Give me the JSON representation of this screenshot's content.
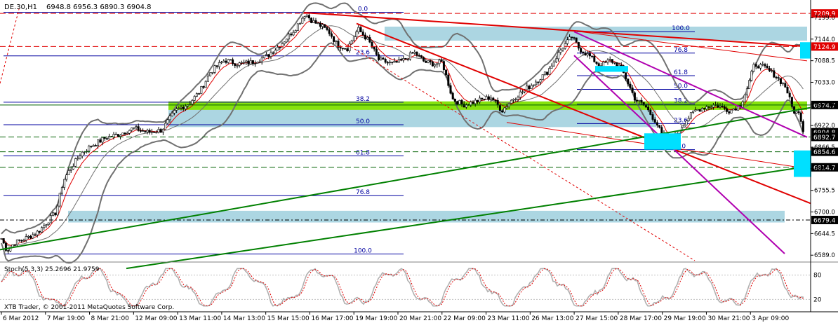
{
  "header": {
    "symbol": "DE.30,H1",
    "ohlc": "6948.8 6956.3 6890.3 6904.8"
  },
  "footer": {
    "copyright": "XTB Trader, © 2001-2011 MetaQuotes Software Corp."
  },
  "colors": {
    "candle": "#000000",
    "bollinger": "#707070",
    "ma": "#e00000",
    "fib": "#0000a0",
    "fib_zone": "#a8d4e0",
    "green_zone": "#7fe000",
    "trend_red": "#e00000",
    "trend_green": "#008000",
    "trend_magenta": "#b000b0",
    "cyan_block": "#00e0ff",
    "stoch_main": "#b0b0b0",
    "stoch_signal": "#e00000"
  },
  "chart_data": {
    "type": "candlestick",
    "instrument": "DE.30",
    "timeframe": "H1",
    "ohlc_last": {
      "open": 6948.8,
      "high": 6956.3,
      "low": 6890.3,
      "close": 6904.8
    },
    "ylim": [
      6575,
      7230
    ],
    "y_ticks": [
      7199.0,
      7144.0,
      7088.5,
      7033.0,
      6977.5,
      6922.0,
      6866.5,
      6811.0,
      6755.5,
      6700.0,
      6644.5,
      6589.0
    ],
    "x_ticks": [
      "6 Mar 2012",
      "7 Mar 19:00",
      "8 Mar 21:00",
      "12 Mar 09:00",
      "13 Mar 11:00",
      "14 Mar 13:00",
      "15 Mar 15:00",
      "16 Mar 17:00",
      "19 Mar 19:00",
      "20 Mar 21:00",
      "22 Mar 09:00",
      "23 Mar 11:00",
      "26 Mar 13:00",
      "27 Mar 15:00",
      "28 Mar 17:00",
      "29 Mar 19:00",
      "30 Mar 21:00",
      "3 Apr 09:00"
    ],
    "path": [
      [
        0,
        6640
      ],
      [
        10,
        6600
      ],
      [
        20,
        6620
      ],
      [
        40,
        6635
      ],
      [
        55,
        6650
      ],
      [
        70,
        6680
      ],
      [
        80,
        6700
      ],
      [
        90,
        6780
      ],
      [
        100,
        6810
      ],
      [
        115,
        6850
      ],
      [
        130,
        6870
      ],
      [
        150,
        6890
      ],
      [
        170,
        6900
      ],
      [
        190,
        6915
      ],
      [
        210,
        6905
      ],
      [
        230,
        6910
      ],
      [
        250,
        6960
      ],
      [
        270,
        6980
      ],
      [
        285,
        7010
      ],
      [
        300,
        7060
      ],
      [
        320,
        7090
      ],
      [
        340,
        7080
      ],
      [
        360,
        7085
      ],
      [
        380,
        7100
      ],
      [
        400,
        7130
      ],
      [
        420,
        7170
      ],
      [
        435,
        7210
      ],
      [
        445,
        7190
      ],
      [
        460,
        7175
      ],
      [
        470,
        7160
      ],
      [
        480,
        7130
      ],
      [
        495,
        7120
      ],
      [
        510,
        7170
      ],
      [
        525,
        7140
      ],
      [
        540,
        7090
      ],
      [
        560,
        7080
      ],
      [
        575,
        7090
      ],
      [
        590,
        7110
      ],
      [
        605,
        7085
      ],
      [
        620,
        7080
      ],
      [
        630,
        7085
      ],
      [
        645,
        6990
      ],
      [
        660,
        6975
      ],
      [
        680,
        6985
      ],
      [
        700,
        6995
      ],
      [
        715,
        6960
      ],
      [
        730,
        6990
      ],
      [
        745,
        7010
      ],
      [
        760,
        7030
      ],
      [
        780,
        7060
      ],
      [
        800,
        7120
      ],
      [
        815,
        7150
      ],
      [
        825,
        7120
      ],
      [
        840,
        7100
      ],
      [
        855,
        7075
      ],
      [
        870,
        7090
      ],
      [
        885,
        7070
      ],
      [
        895,
        7030
      ],
      [
        905,
        6990
      ],
      [
        920,
        6970
      ],
      [
        935,
        6930
      ],
      [
        950,
        6870
      ],
      [
        960,
        6890
      ],
      [
        975,
        6930
      ],
      [
        990,
        6960
      ],
      [
        1005,
        6970
      ],
      [
        1020,
        6975
      ],
      [
        1040,
        6960
      ],
      [
        1055,
        6975
      ],
      [
        1065,
        7020
      ],
      [
        1075,
        7080
      ],
      [
        1090,
        7070
      ],
      [
        1105,
        7050
      ],
      [
        1120,
        7020
      ],
      [
        1130,
        6960
      ],
      [
        1140,
        6950
      ],
      [
        1145,
        6904.8
      ]
    ],
    "fib_left": {
      "x1": 5,
      "x2": 575,
      "anchor_x": 517,
      "levels": [
        {
          "label": "0.0",
          "price": 7213
        },
        {
          "label": "23.6",
          "price": 7101
        },
        {
          "label": "38.2",
          "price": 6982
        },
        {
          "label": "50.0",
          "price": 6924
        },
        {
          "label": "61.8",
          "price": 6844
        },
        {
          "label": "76.8",
          "price": 6742
        },
        {
          "label": "100.0",
          "price": 6592
        }
      ]
    },
    "fib_right": {
      "x1": 822,
      "x2": 990,
      "anchor_x": 970,
      "levels": [
        {
          "label": "100.0",
          "price": 7163
        },
        {
          "label": "76.8",
          "price": 7108
        },
        {
          "label": "61.8",
          "price": 7050
        },
        {
          "label": "50.0",
          "price": 7015
        },
        {
          "label": "38.2",
          "price": 6977
        },
        {
          "label": "23.6",
          "price": 6927
        },
        {
          "label": "0.0",
          "price": 6860
        }
      ]
    },
    "horizontal_levels": [
      {
        "price": 7209.9,
        "label": "7209.9",
        "color": "#e00000",
        "style": "dashed"
      },
      {
        "price": 7124.9,
        "label": "7124.9",
        "color": "#e00000",
        "style": "dashed"
      },
      {
        "price": 6974.7,
        "label": "6974.7",
        "color": "#006000",
        "style": "solid"
      },
      {
        "price": 6904.8,
        "label": "6904.8",
        "color": "#000000",
        "style": "solid"
      },
      {
        "price": 6892.7,
        "label": "6892.7",
        "color": "#006000",
        "style": "dashed"
      },
      {
        "price": 6854.6,
        "label": "6854.6",
        "color": "#006000",
        "style": "dashed"
      },
      {
        "price": 6814.7,
        "label": "6814.7",
        "color": "#006000",
        "style": "dashed"
      },
      {
        "price": 6679.4,
        "label": "6679.4",
        "color": "#000000",
        "style": "dashdot"
      }
    ],
    "zones": [
      {
        "x1": 548,
        "x2": 1150,
        "p1": 7176,
        "p2": 7140,
        "color": "#a8d4e0"
      },
      {
        "x1": 240,
        "x2": 1150,
        "p1": 6984,
        "p2": 6962,
        "color": "#7fe000"
      },
      {
        "x1": 240,
        "x2": 935,
        "p1": 6962,
        "p2": 6918,
        "color": "#a8d4e0"
      },
      {
        "x1": 97,
        "x2": 1118,
        "p1": 6703,
        "p2": 6673,
        "color": "#a8d4e0"
      }
    ],
    "cyan_blocks": [
      {
        "x1": 918,
        "x2": 970,
        "p1": 6902,
        "p2": 6860
      },
      {
        "x1": 848,
        "x2": 895,
        "p1": 7075,
        "p2": 7060
      },
      {
        "x1": 1140,
        "x2": 1155,
        "p1": 7136,
        "p2": 7094
      },
      {
        "x1": 1131,
        "x2": 1156,
        "p1": 6858,
        "p2": 6790
      }
    ],
    "trendlines": [
      {
        "x1": 433,
        "p1": 7212,
        "x2": 1150,
        "p2": 7125,
        "color": "#e00000",
        "width": 2
      },
      {
        "x1": 818,
        "p1": 7165,
        "x2": 1150,
        "p2": 7088,
        "color": "#e00000",
        "width": 1
      },
      {
        "x1": 508,
        "p1": 7184,
        "x2": 1155,
        "p2": 6722,
        "color": "#e00000",
        "width": 2
      },
      {
        "x1": 722,
        "p1": 6930,
        "x2": 1155,
        "p2": 6810,
        "color": "#e00000",
        "width": 1
      },
      {
        "x1": 495,
        "p1": 7130,
        "x2": 990,
        "p2": 6575,
        "color": "#e00000",
        "width": 1,
        "dash": true
      },
      {
        "x1": 0,
        "p1": 6603,
        "x2": 1155,
        "p2": 6968,
        "color": "#008000",
        "width": 2
      },
      {
        "x1": 180,
        "p1": 6555,
        "x2": 1155,
        "p2": 6818,
        "color": "#008000",
        "width": 2
      },
      {
        "x1": 818,
        "p1": 7163,
        "x2": 1150,
        "p2": 6892,
        "color": "#b000b0",
        "width": 2
      },
      {
        "x1": 818,
        "p1": 7102,
        "x2": 1118,
        "p2": 6593,
        "color": "#b000b0",
        "width": 2
      },
      {
        "x1": 0,
        "p1": 7030,
        "x2": 28,
        "p2": 7228,
        "color": "#e00000",
        "width": 1,
        "dash": true
      }
    ],
    "stochastic": {
      "label": "Stoch(5,3,3) 25.2696 21.9759",
      "main_value": 25.2696,
      "signal_value": 21.9759,
      "ylim": [
        0,
        100
      ],
      "y_ticks": [
        80,
        20
      ]
    }
  }
}
